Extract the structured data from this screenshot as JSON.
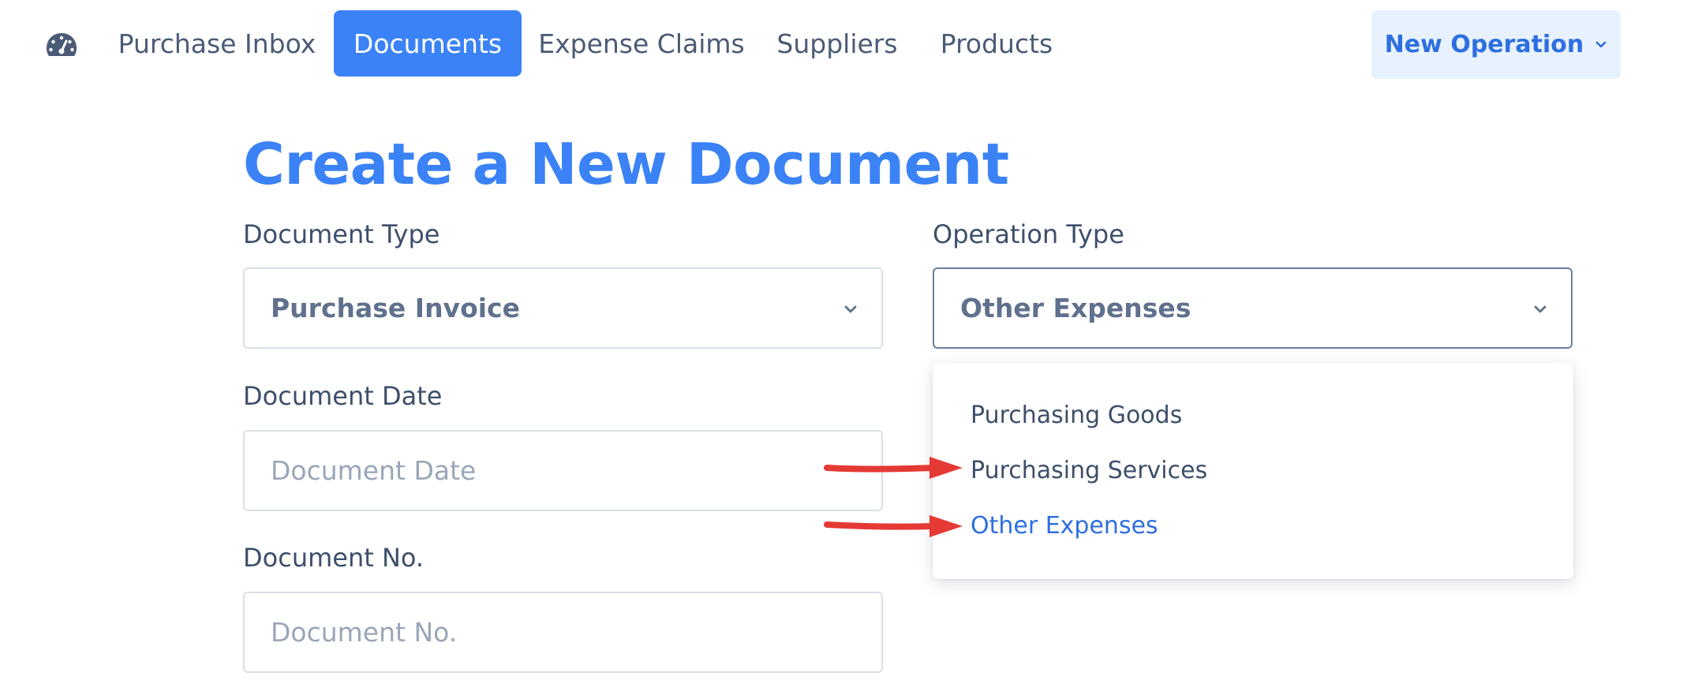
{
  "nav": {
    "tabs": [
      {
        "label": "Purchase Inbox",
        "active": false
      },
      {
        "label": "Documents",
        "active": true
      },
      {
        "label": "Expense Claims",
        "active": false
      },
      {
        "label": "Suppliers",
        "active": false
      },
      {
        "label": "Products",
        "active": false
      }
    ],
    "new_operation_label": "New Operation",
    "icon": "dashboard-gauge-icon"
  },
  "page": {
    "title": "Create a New Document"
  },
  "form": {
    "document_type": {
      "label": "Document Type",
      "value": "Purchase Invoice"
    },
    "operation_type": {
      "label": "Operation Type",
      "value": "Other Expenses",
      "options": [
        {
          "label": "Purchasing Goods",
          "selected": false
        },
        {
          "label": "Purchasing Services",
          "selected": false
        },
        {
          "label": "Other Expenses",
          "selected": true
        }
      ]
    },
    "document_date": {
      "label": "Document Date",
      "placeholder": "Document Date",
      "value": ""
    },
    "document_no": {
      "label": "Document No.",
      "placeholder": "Document No.",
      "value": ""
    }
  },
  "colors": {
    "accent": "#3b82f6",
    "accent_text": "#2e6fe0",
    "button_bg": "#e8f1fe",
    "text": "#3d4f6b",
    "annotation_arrow": "#e53935"
  }
}
